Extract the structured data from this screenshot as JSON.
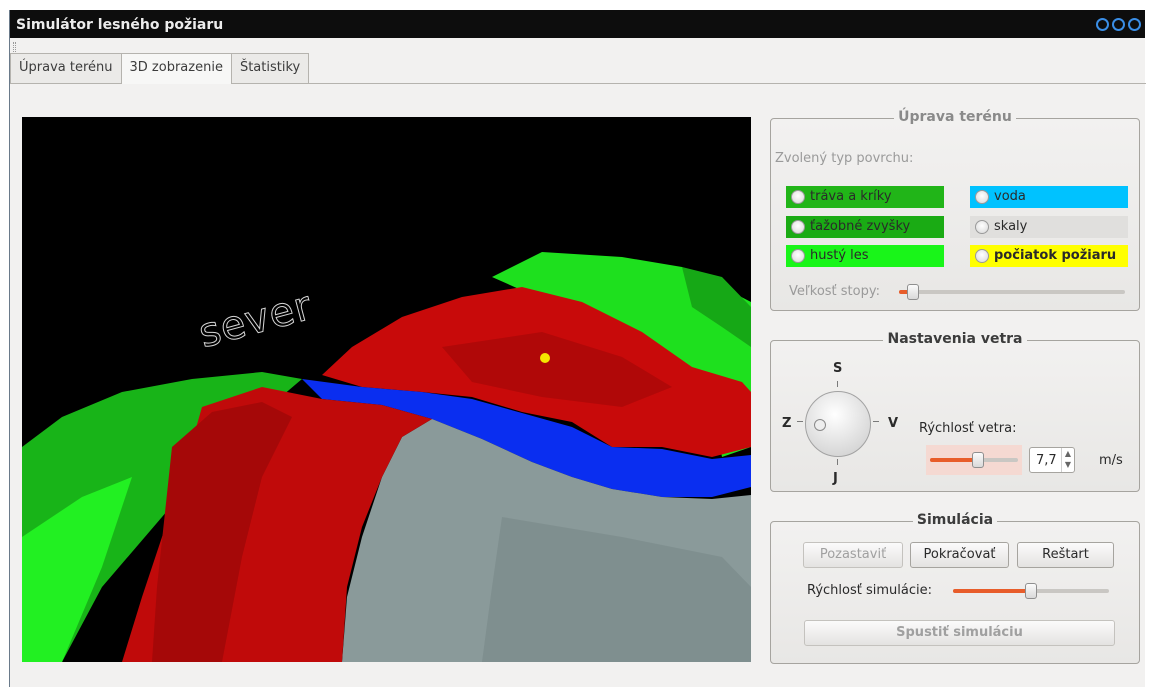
{
  "window": {
    "title": "Simulátor lesného požiaru"
  },
  "tabs": [
    {
      "label": "Úprava terénu",
      "active": false
    },
    {
      "label": "3D zobrazenie",
      "active": true
    },
    {
      "label": "Štatistiky",
      "active": false
    }
  ],
  "view3d": {
    "direction_label": "sever"
  },
  "terrain_panel": {
    "title": "Úprava terénu",
    "surface_label": "Zvolený typ povrchu:",
    "surfaces": [
      {
        "label": "tráva a kríky",
        "color": "#21b518"
      },
      {
        "label": "voda",
        "color": "#00c2ff"
      },
      {
        "label": "ťažobné zvyšky",
        "color": "#1aab14"
      },
      {
        "label": "skaly",
        "color": "#e0dfdd"
      },
      {
        "label": "hustý les",
        "color": "#19f519"
      },
      {
        "label": "počiatok požiaru",
        "color": "#ffff00"
      }
    ],
    "brush_label": "Veľkosť stopy:",
    "brush_value": 0.06
  },
  "wind_panel": {
    "title": "Nastavenia vetra",
    "north": "S",
    "south": "J",
    "west": "Z",
    "east": "V",
    "speed_label": "Rýchlosť vetra:",
    "speed_value": "7,7",
    "speed_unit": "m/s",
    "slider_value": 0.55
  },
  "sim_panel": {
    "title": "Simulácia",
    "pause_label": "Pozastaviť",
    "continue_label": "Pokračovať",
    "restart_label": "Reštart",
    "speed_label": "Rýchlosť simulácie:",
    "speed_value": 0.5,
    "start_label": "Spustiť simuláciu"
  }
}
